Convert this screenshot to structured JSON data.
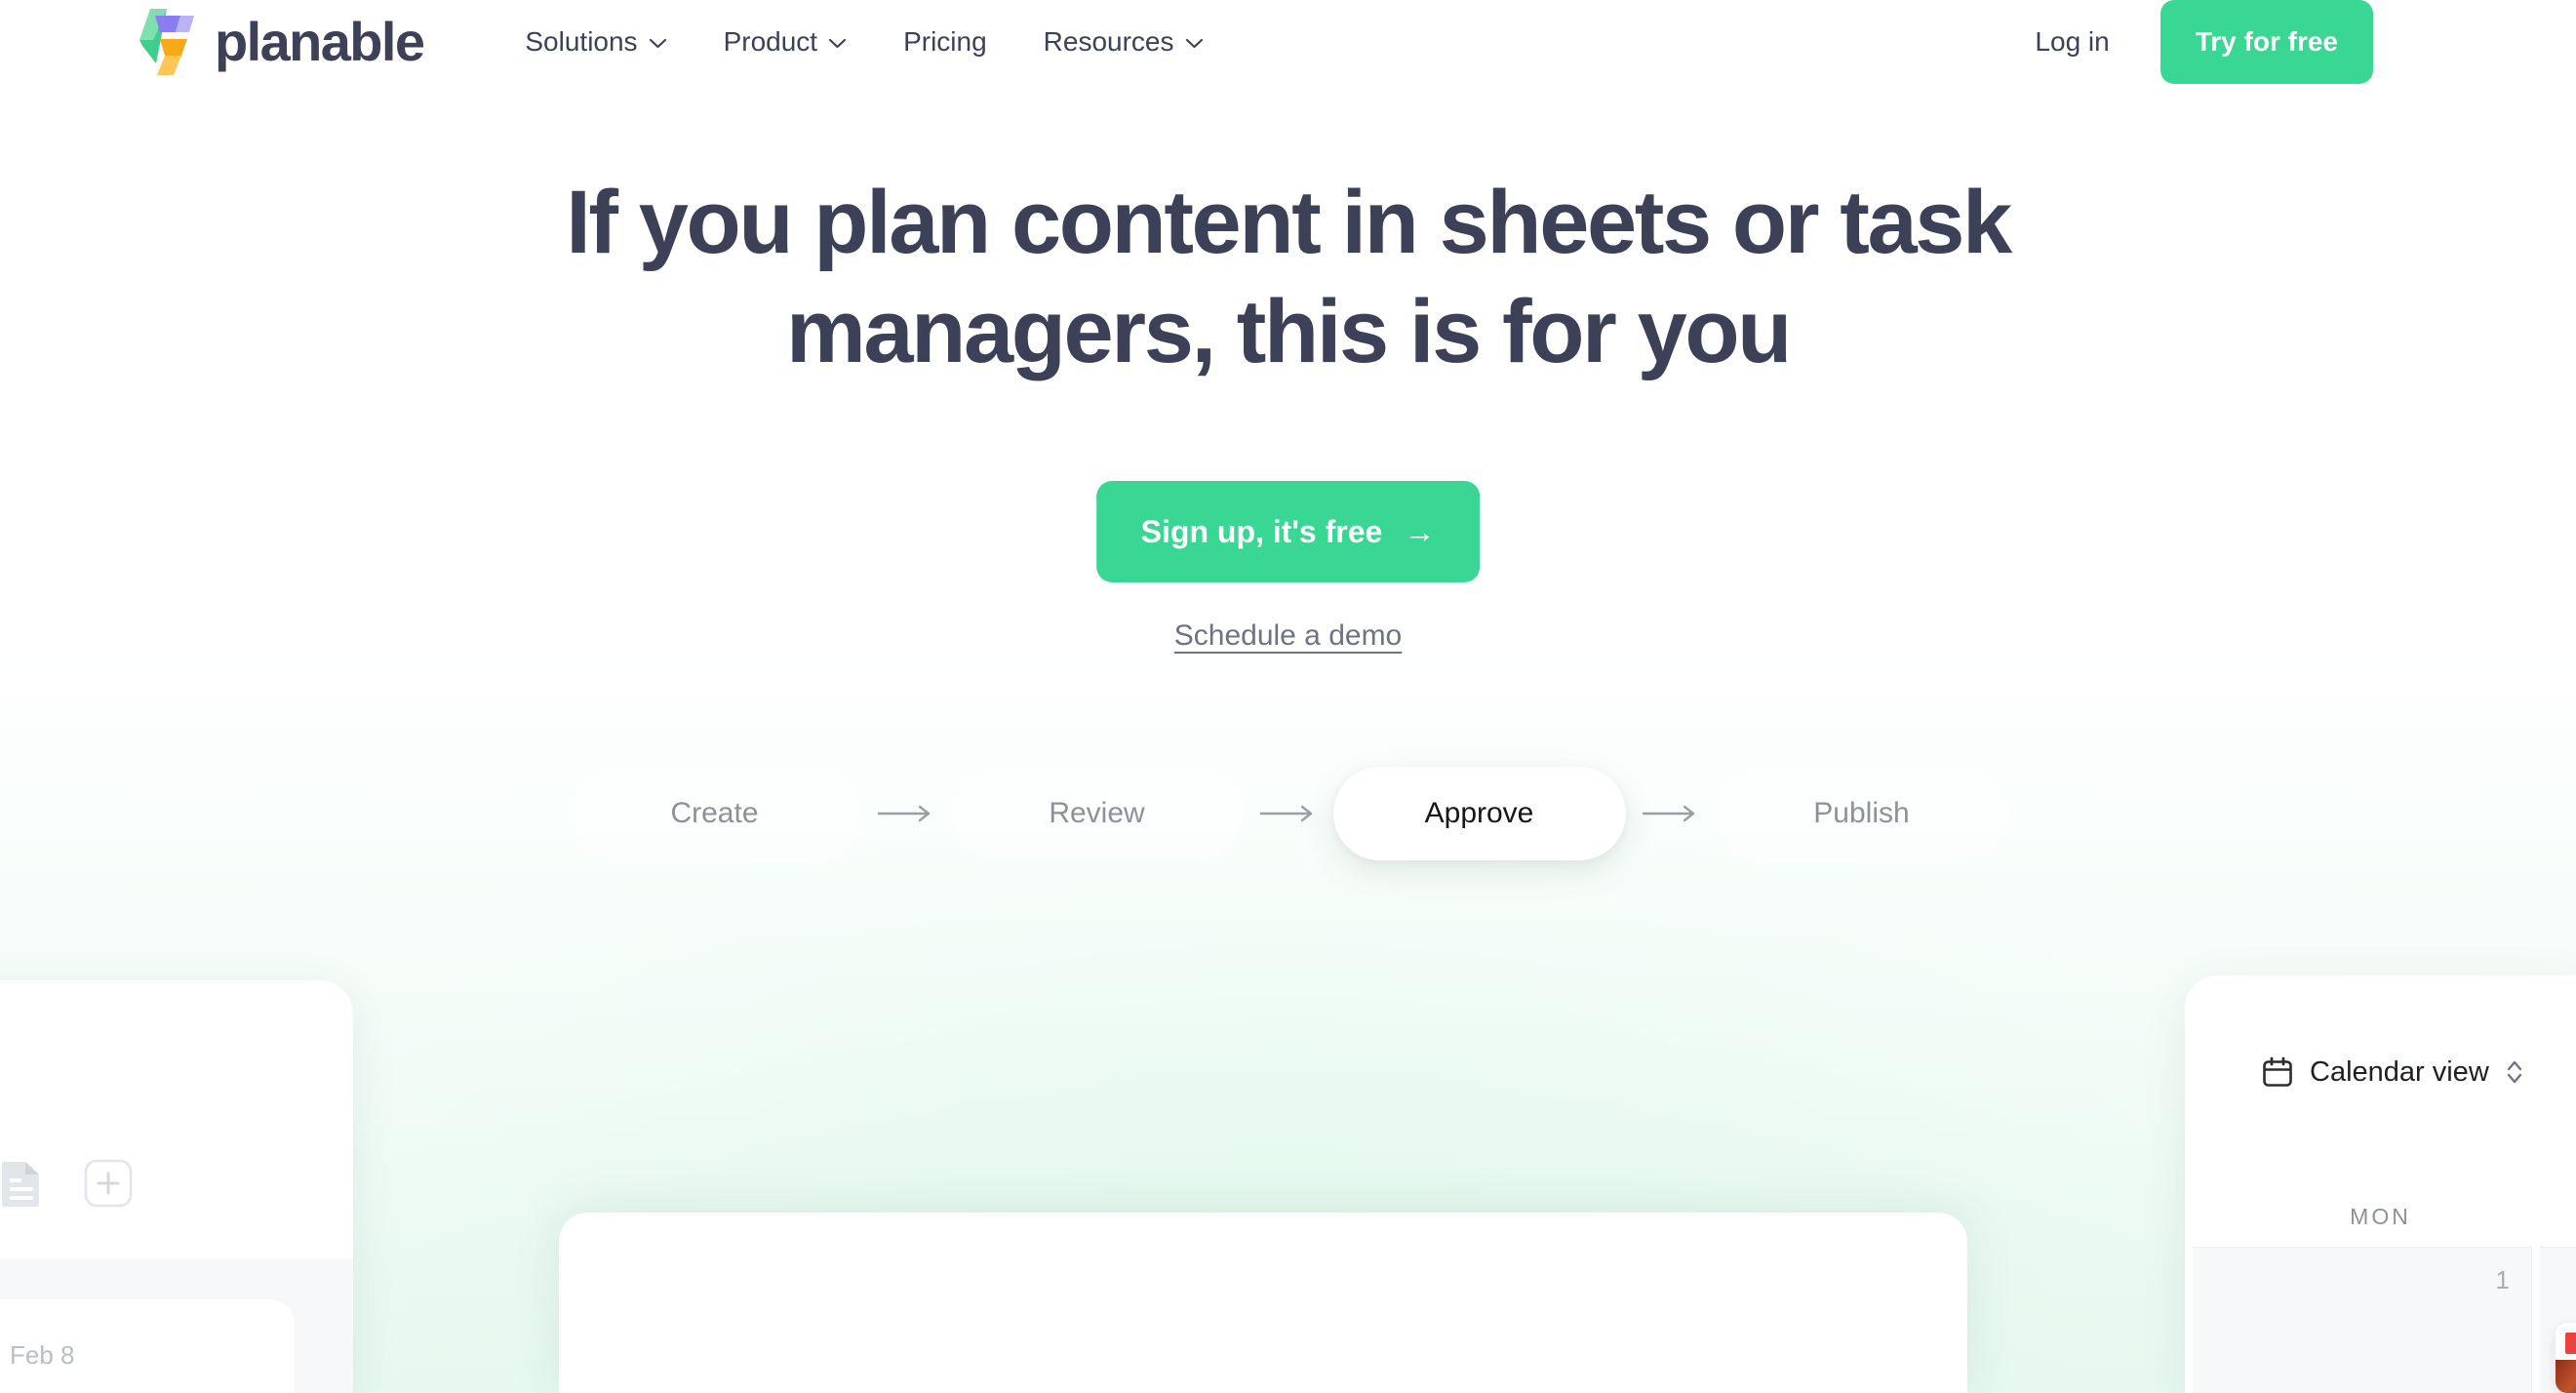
{
  "brand": {
    "name": "planable",
    "logo_icon": "planable-ribbon-logo",
    "colors": {
      "green": "#3ecf8e",
      "purple": "#8b7cf0",
      "purple_light": "#bcb3f7",
      "orange": "#f9a81a",
      "orange_light": "#fcc756",
      "wordmark": "#3d4158"
    }
  },
  "header": {
    "nav": [
      {
        "label": "Solutions",
        "has_dropdown": true
      },
      {
        "label": "Product",
        "has_dropdown": true
      },
      {
        "label": "Pricing",
        "has_dropdown": false
      },
      {
        "label": "Resources",
        "has_dropdown": true
      }
    ],
    "login_label": "Log in",
    "cta_label": "Try for free",
    "cta_color": "#3ad694"
  },
  "hero": {
    "headline": "If you plan content in sheets or task managers, this is for you",
    "primary_cta": "Sign up, it's free",
    "primary_cta_arrow": "→",
    "primary_cta_color": "#3ad694",
    "secondary_cta": "Schedule a demo"
  },
  "workflow": {
    "steps": [
      {
        "label": "Create",
        "active": false
      },
      {
        "label": "Review",
        "active": false
      },
      {
        "label": "Approve",
        "active": true
      },
      {
        "label": "Publish",
        "active": false
      }
    ],
    "arrow": "→"
  },
  "left_panel": {
    "doc_icon": "document-icon",
    "add_icon": "plus-icon",
    "date_label": "Feb 8"
  },
  "right_panel": {
    "view_icon": "calendar-icon",
    "view_label": "Calendar view",
    "view_selector_icon": "chevron-up-down-icon",
    "day_header": "MON",
    "day_number": "1"
  }
}
